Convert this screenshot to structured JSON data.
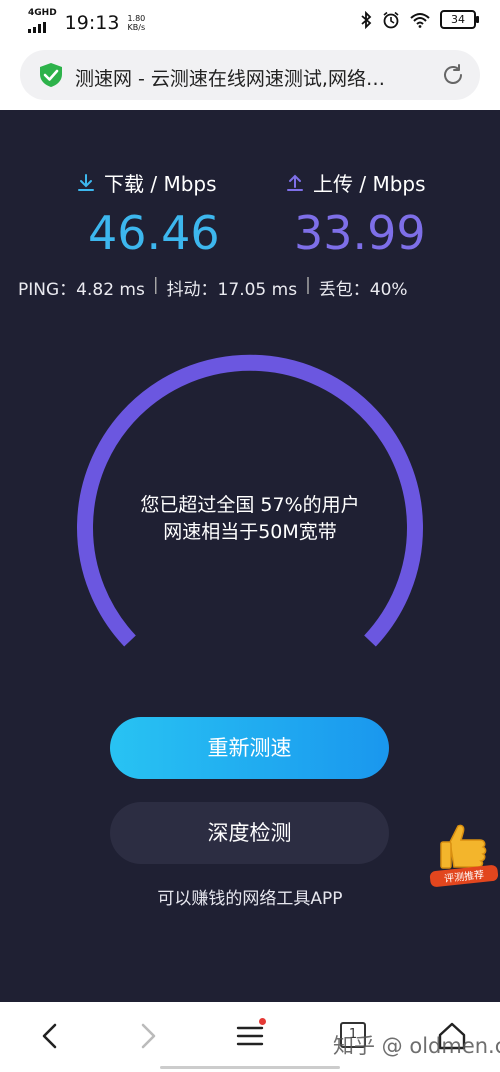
{
  "status": {
    "network": "4G",
    "network_sub": "HD",
    "time": "19:13",
    "speed_value": "1.80",
    "speed_unit": "KB/s",
    "battery": "34",
    "icons": [
      "bluetooth-icon",
      "alarm-icon",
      "wifi-icon",
      "battery-icon"
    ]
  },
  "browser": {
    "title": "测速网 - 云测速在线网速测试,网络…",
    "shield_color": "#2db24a"
  },
  "result": {
    "download_label": "下载 / Mbps",
    "download_value": "46.46",
    "upload_label": "上传 / Mbps",
    "upload_value": "33.99",
    "ping": "PING：4.82 ms",
    "jitter": "抖动：17.05 ms",
    "loss": "丢包：40%",
    "summary_line1": "您已超过全国 57%的用户",
    "summary_line2": "网速相当于50M宽带",
    "colors": {
      "download": "#3db7ee",
      "upload": "#7e6fe8",
      "gauge": "#6b57e0"
    }
  },
  "actions": {
    "retest": "重新测速",
    "deep_check": "深度检测",
    "promo": "可以赚钱的网络工具APP",
    "badge": "评测推荐"
  },
  "nav": {
    "tab_count": "1",
    "icons": [
      "back-icon",
      "forward-icon",
      "menu-icon",
      "tabs-icon",
      "home-icon"
    ]
  },
  "watermark": "知乎 @ oldmen.cn"
}
